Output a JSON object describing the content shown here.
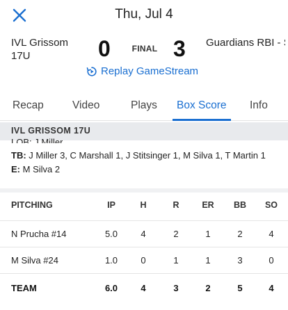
{
  "header": {
    "date": "Thu, Jul 4",
    "close_icon": "close-x-icon"
  },
  "game": {
    "team_left": "IVL Grissom 17U",
    "score_left": "0",
    "status": "FINAL",
    "score_right": "3",
    "team_right": "Guardians RBI - Sr Baseball..."
  },
  "replay": {
    "label": "Replay GameStream",
    "icon": "replay-icon"
  },
  "tabs": [
    {
      "label": "Recap"
    },
    {
      "label": "Video"
    },
    {
      "label": "Plays"
    },
    {
      "label": "Box Score",
      "active": true
    },
    {
      "label": "Info"
    }
  ],
  "section": {
    "title": "IVL GRISSOM 17U"
  },
  "batting_notes": {
    "clipped_text": "LOB: J Miller",
    "tb_label": "TB:",
    "tb_text": "J Miller 3, C Marshall 1, J Stitsinger 1, M Silva 1, T Martin 1",
    "e_label": "E:",
    "e_text": "M Silva 2"
  },
  "pitching": {
    "columns": [
      "PITCHING",
      "IP",
      "H",
      "R",
      "ER",
      "BB",
      "SO"
    ],
    "rows": [
      [
        "N Prucha #14",
        "5.0",
        "4",
        "2",
        "1",
        "2",
        "4"
      ],
      [
        "M Silva #24",
        "1.0",
        "0",
        "1",
        "1",
        "3",
        "0"
      ]
    ],
    "total": [
      "TEAM",
      "6.0",
      "4",
      "3",
      "2",
      "5",
      "4"
    ]
  },
  "colors": {
    "accent": "#1a6fd1",
    "section_bg": "#e8eaed"
  }
}
